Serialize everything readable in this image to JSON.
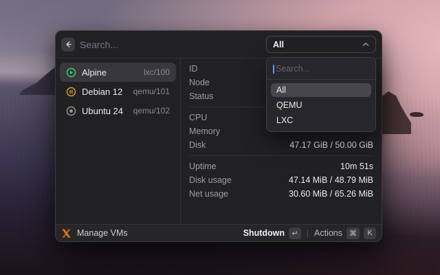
{
  "topbar": {
    "search_placeholder": "Search...",
    "filter_value": "All"
  },
  "vm_list": [
    {
      "name": "Alpine",
      "badge": "lxc/100",
      "status": "running",
      "selected": true
    },
    {
      "name": "Debian 12",
      "badge": "qemu/101",
      "status": "paused",
      "selected": false
    },
    {
      "name": "Ubuntu 24",
      "badge": "qemu/102",
      "status": "stopped",
      "selected": false
    }
  ],
  "details": {
    "groups": [
      {
        "rows": [
          {
            "label": "ID",
            "value": ""
          },
          {
            "label": "Node",
            "value": ""
          },
          {
            "label": "Status",
            "value": ""
          }
        ]
      },
      {
        "rows": [
          {
            "label": "CPU",
            "value": ""
          },
          {
            "label": "Memory",
            "value": ""
          },
          {
            "label": "Disk",
            "value": "47.17 GiB / 50.00 GiB"
          }
        ]
      },
      {
        "rows": [
          {
            "label": "Uptime",
            "value": "10m 51s"
          },
          {
            "label": "Disk usage",
            "value": "47.14 MiB / 48.79 MiB"
          },
          {
            "label": "Net usage",
            "value": "30.60 MiB / 65.26 MiB"
          }
        ]
      }
    ]
  },
  "filter_dropdown": {
    "search_placeholder": "Search...",
    "items": [
      {
        "label": "All",
        "selected": true
      },
      {
        "label": "QEMU",
        "selected": false
      },
      {
        "label": "LXC",
        "selected": false
      }
    ]
  },
  "footer": {
    "app_label": "Manage VMs",
    "primary_action": {
      "label": "Shutdown",
      "key": "↵"
    },
    "secondary_action": {
      "label": "Actions",
      "keys": [
        "⌘",
        "K"
      ]
    }
  },
  "colors": {
    "proxmox_orange": "#E57000",
    "status_running": "#3DD266",
    "status_paused": "#DFA32F",
    "status_stopped": "#98989E",
    "caret_blue": "#5F9DF5"
  }
}
